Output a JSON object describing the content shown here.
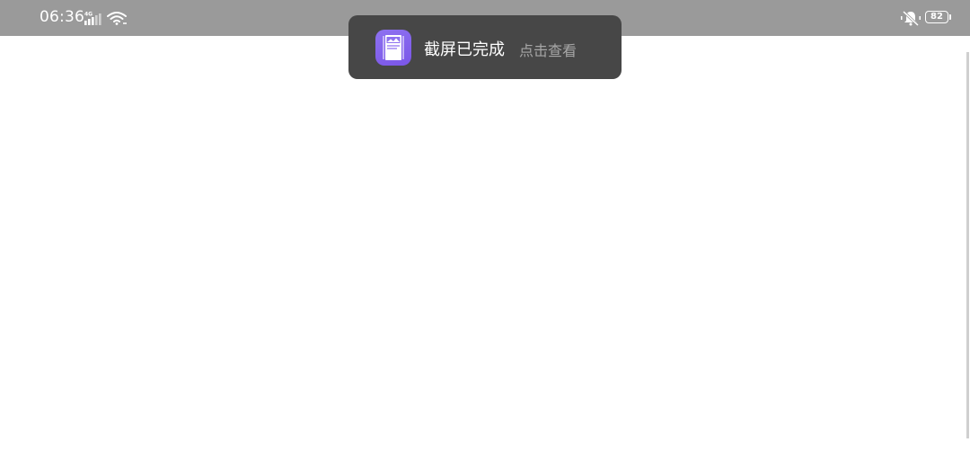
{
  "status_bar": {
    "time": "06:36",
    "network_label": "4G",
    "battery_level": "82",
    "icons": [
      "signal-icon",
      "wifi-icon",
      "vibrate-icon",
      "battery-icon"
    ]
  },
  "toast": {
    "title": "截屏已完成",
    "action": "点击查看",
    "icon": "screenshot-app-icon"
  },
  "colors": {
    "status_bar_bg": "#9a9a9a",
    "toast_bg": "#474747",
    "app_icon": "#8e72f0",
    "action_text": "#a6a6a6"
  }
}
